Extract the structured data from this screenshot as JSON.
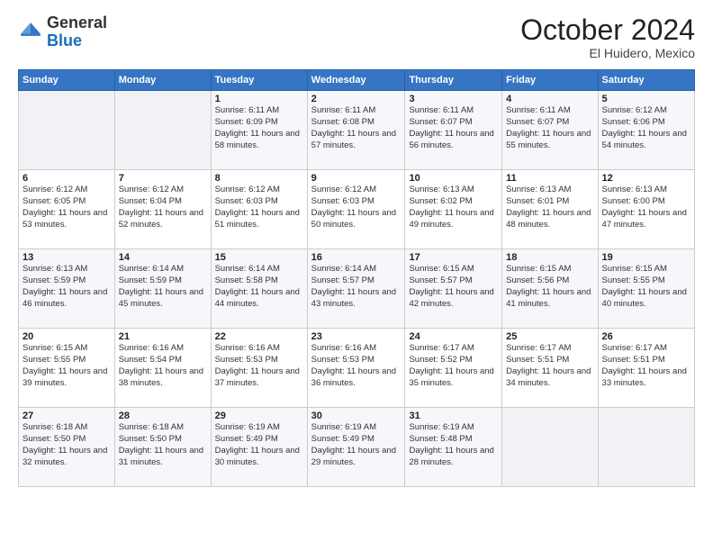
{
  "header": {
    "logo_general": "General",
    "logo_blue": "Blue",
    "month": "October 2024",
    "location": "El Huidero, Mexico"
  },
  "days_of_week": [
    "Sunday",
    "Monday",
    "Tuesday",
    "Wednesday",
    "Thursday",
    "Friday",
    "Saturday"
  ],
  "weeks": [
    [
      {
        "day": "",
        "sunrise": "",
        "sunset": "",
        "daylight": ""
      },
      {
        "day": "",
        "sunrise": "",
        "sunset": "",
        "daylight": ""
      },
      {
        "day": "1",
        "sunrise": "Sunrise: 6:11 AM",
        "sunset": "Sunset: 6:09 PM",
        "daylight": "Daylight: 11 hours and 58 minutes."
      },
      {
        "day": "2",
        "sunrise": "Sunrise: 6:11 AM",
        "sunset": "Sunset: 6:08 PM",
        "daylight": "Daylight: 11 hours and 57 minutes."
      },
      {
        "day": "3",
        "sunrise": "Sunrise: 6:11 AM",
        "sunset": "Sunset: 6:07 PM",
        "daylight": "Daylight: 11 hours and 56 minutes."
      },
      {
        "day": "4",
        "sunrise": "Sunrise: 6:11 AM",
        "sunset": "Sunset: 6:07 PM",
        "daylight": "Daylight: 11 hours and 55 minutes."
      },
      {
        "day": "5",
        "sunrise": "Sunrise: 6:12 AM",
        "sunset": "Sunset: 6:06 PM",
        "daylight": "Daylight: 11 hours and 54 minutes."
      }
    ],
    [
      {
        "day": "6",
        "sunrise": "Sunrise: 6:12 AM",
        "sunset": "Sunset: 6:05 PM",
        "daylight": "Daylight: 11 hours and 53 minutes."
      },
      {
        "day": "7",
        "sunrise": "Sunrise: 6:12 AM",
        "sunset": "Sunset: 6:04 PM",
        "daylight": "Daylight: 11 hours and 52 minutes."
      },
      {
        "day": "8",
        "sunrise": "Sunrise: 6:12 AM",
        "sunset": "Sunset: 6:03 PM",
        "daylight": "Daylight: 11 hours and 51 minutes."
      },
      {
        "day": "9",
        "sunrise": "Sunrise: 6:12 AM",
        "sunset": "Sunset: 6:03 PM",
        "daylight": "Daylight: 11 hours and 50 minutes."
      },
      {
        "day": "10",
        "sunrise": "Sunrise: 6:13 AM",
        "sunset": "Sunset: 6:02 PM",
        "daylight": "Daylight: 11 hours and 49 minutes."
      },
      {
        "day": "11",
        "sunrise": "Sunrise: 6:13 AM",
        "sunset": "Sunset: 6:01 PM",
        "daylight": "Daylight: 11 hours and 48 minutes."
      },
      {
        "day": "12",
        "sunrise": "Sunrise: 6:13 AM",
        "sunset": "Sunset: 6:00 PM",
        "daylight": "Daylight: 11 hours and 47 minutes."
      }
    ],
    [
      {
        "day": "13",
        "sunrise": "Sunrise: 6:13 AM",
        "sunset": "Sunset: 5:59 PM",
        "daylight": "Daylight: 11 hours and 46 minutes."
      },
      {
        "day": "14",
        "sunrise": "Sunrise: 6:14 AM",
        "sunset": "Sunset: 5:59 PM",
        "daylight": "Daylight: 11 hours and 45 minutes."
      },
      {
        "day": "15",
        "sunrise": "Sunrise: 6:14 AM",
        "sunset": "Sunset: 5:58 PM",
        "daylight": "Daylight: 11 hours and 44 minutes."
      },
      {
        "day": "16",
        "sunrise": "Sunrise: 6:14 AM",
        "sunset": "Sunset: 5:57 PM",
        "daylight": "Daylight: 11 hours and 43 minutes."
      },
      {
        "day": "17",
        "sunrise": "Sunrise: 6:15 AM",
        "sunset": "Sunset: 5:57 PM",
        "daylight": "Daylight: 11 hours and 42 minutes."
      },
      {
        "day": "18",
        "sunrise": "Sunrise: 6:15 AM",
        "sunset": "Sunset: 5:56 PM",
        "daylight": "Daylight: 11 hours and 41 minutes."
      },
      {
        "day": "19",
        "sunrise": "Sunrise: 6:15 AM",
        "sunset": "Sunset: 5:55 PM",
        "daylight": "Daylight: 11 hours and 40 minutes."
      }
    ],
    [
      {
        "day": "20",
        "sunrise": "Sunrise: 6:15 AM",
        "sunset": "Sunset: 5:55 PM",
        "daylight": "Daylight: 11 hours and 39 minutes."
      },
      {
        "day": "21",
        "sunrise": "Sunrise: 6:16 AM",
        "sunset": "Sunset: 5:54 PM",
        "daylight": "Daylight: 11 hours and 38 minutes."
      },
      {
        "day": "22",
        "sunrise": "Sunrise: 6:16 AM",
        "sunset": "Sunset: 5:53 PM",
        "daylight": "Daylight: 11 hours and 37 minutes."
      },
      {
        "day": "23",
        "sunrise": "Sunrise: 6:16 AM",
        "sunset": "Sunset: 5:53 PM",
        "daylight": "Daylight: 11 hours and 36 minutes."
      },
      {
        "day": "24",
        "sunrise": "Sunrise: 6:17 AM",
        "sunset": "Sunset: 5:52 PM",
        "daylight": "Daylight: 11 hours and 35 minutes."
      },
      {
        "day": "25",
        "sunrise": "Sunrise: 6:17 AM",
        "sunset": "Sunset: 5:51 PM",
        "daylight": "Daylight: 11 hours and 34 minutes."
      },
      {
        "day": "26",
        "sunrise": "Sunrise: 6:17 AM",
        "sunset": "Sunset: 5:51 PM",
        "daylight": "Daylight: 11 hours and 33 minutes."
      }
    ],
    [
      {
        "day": "27",
        "sunrise": "Sunrise: 6:18 AM",
        "sunset": "Sunset: 5:50 PM",
        "daylight": "Daylight: 11 hours and 32 minutes."
      },
      {
        "day": "28",
        "sunrise": "Sunrise: 6:18 AM",
        "sunset": "Sunset: 5:50 PM",
        "daylight": "Daylight: 11 hours and 31 minutes."
      },
      {
        "day": "29",
        "sunrise": "Sunrise: 6:19 AM",
        "sunset": "Sunset: 5:49 PM",
        "daylight": "Daylight: 11 hours and 30 minutes."
      },
      {
        "day": "30",
        "sunrise": "Sunrise: 6:19 AM",
        "sunset": "Sunset: 5:49 PM",
        "daylight": "Daylight: 11 hours and 29 minutes."
      },
      {
        "day": "31",
        "sunrise": "Sunrise: 6:19 AM",
        "sunset": "Sunset: 5:48 PM",
        "daylight": "Daylight: 11 hours and 28 minutes."
      },
      {
        "day": "",
        "sunrise": "",
        "sunset": "",
        "daylight": ""
      },
      {
        "day": "",
        "sunrise": "",
        "sunset": "",
        "daylight": ""
      }
    ]
  ]
}
